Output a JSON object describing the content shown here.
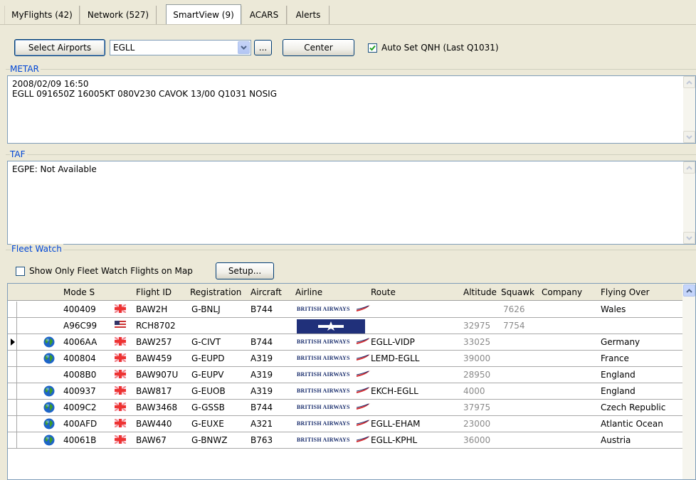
{
  "tabs": [
    {
      "label": "MyFlights (42)"
    },
    {
      "label": "Network (527)"
    },
    {
      "label": "SmartView (9)"
    },
    {
      "label": "ACARS"
    },
    {
      "label": "Alerts"
    }
  ],
  "toolbar": {
    "select_airports_label": "Select Airports",
    "airport_value": "EGLL",
    "ellipsis_label": "...",
    "center_label": "Center",
    "auto_qnh_label": "Auto Set QNH (Last Q1031)",
    "auto_qnh_checked": true
  },
  "metar": {
    "title": "METAR",
    "text": "2008/02/09 16:50\nEGLL 091650Z 16005KT 080V230 CAVOK 13/00 Q1031 NOSIG"
  },
  "taf": {
    "title": "TAF",
    "text": "EGPE: Not Available"
  },
  "fleet_watch": {
    "title": "Fleet Watch",
    "show_only_label": "Show Only Fleet Watch Flights on Map",
    "show_only_checked": false,
    "setup_label": "Setup..."
  },
  "grid": {
    "columns": [
      "Mode S",
      "Flight ID",
      "Registration",
      "Aircraft",
      "Airline",
      "Route",
      "Altitude",
      "Squawk",
      "Company",
      "Flying Over"
    ],
    "airline_logo_text": "BRITISH AIRWAYS",
    "rows": [
      {
        "mode_s": "400409",
        "flag": "uk",
        "globe": false,
        "flight_id": "BAW2H",
        "registration": "G-BNLJ",
        "aircraft": "B744",
        "airline": "ba",
        "route": "",
        "altitude": "",
        "squawk": "7626",
        "company": "",
        "flying_over": "Wales",
        "selected": false
      },
      {
        "mode_s": "A96C99",
        "flag": "us",
        "globe": false,
        "flight_id": "RCH8702",
        "registration": "",
        "aircraft": "",
        "airline": "usaf",
        "route": "",
        "altitude": "32975",
        "squawk": "7754",
        "company": "",
        "flying_over": "",
        "selected": false
      },
      {
        "mode_s": "4006AA",
        "flag": "uk",
        "globe": true,
        "flight_id": "BAW257",
        "registration": "G-CIVT",
        "aircraft": "B744",
        "airline": "ba",
        "route": "EGLL-VIDP",
        "altitude": "33025",
        "squawk": "",
        "company": "",
        "flying_over": "Germany",
        "selected": true
      },
      {
        "mode_s": "400804",
        "flag": "uk",
        "globe": true,
        "flight_id": "BAW459",
        "registration": "G-EUPD",
        "aircraft": "A319",
        "airline": "ba",
        "route": "LEMD-EGLL",
        "altitude": "39000",
        "squawk": "",
        "company": "",
        "flying_over": "France",
        "selected": false
      },
      {
        "mode_s": "4008B0",
        "flag": "uk",
        "globe": false,
        "flight_id": "BAW907U",
        "registration": "G-EUPV",
        "aircraft": "A319",
        "airline": "ba",
        "route": "",
        "altitude": "28950",
        "squawk": "",
        "company": "",
        "flying_over": "England",
        "selected": false
      },
      {
        "mode_s": "400937",
        "flag": "uk",
        "globe": true,
        "flight_id": "BAW817",
        "registration": "G-EUOB",
        "aircraft": "A319",
        "airline": "ba",
        "route": "EKCH-EGLL",
        "altitude": "4000",
        "squawk": "",
        "company": "",
        "flying_over": "England",
        "selected": false
      },
      {
        "mode_s": "4009C2",
        "flag": "uk",
        "globe": true,
        "flight_id": "BAW3468",
        "registration": "G-GSSB",
        "aircraft": "B744",
        "airline": "ba",
        "route": "",
        "altitude": "37975",
        "squawk": "",
        "company": "",
        "flying_over": "Czech Republic",
        "selected": false
      },
      {
        "mode_s": "400AFD",
        "flag": "uk",
        "globe": true,
        "flight_id": "BAW440",
        "registration": "G-EUXE",
        "aircraft": "A321",
        "airline": "ba",
        "route": "EGLL-EHAM",
        "altitude": "23000",
        "squawk": "",
        "company": "",
        "flying_over": "Atlantic Ocean",
        "selected": false
      },
      {
        "mode_s": "40061B",
        "flag": "uk",
        "globe": true,
        "flight_id": "BAW67",
        "registration": "G-BNWZ",
        "aircraft": "B763",
        "airline": "ba",
        "route": "EGLL-KPHL",
        "altitude": "36000",
        "squawk": "",
        "company": "",
        "flying_over": "Austria",
        "selected": false
      }
    ]
  },
  "colors": {
    "window_bg": "#ece9d8",
    "group_title": "#0046d5",
    "ba_blue": "#1b2f6e",
    "ba_red": "#d4262a"
  }
}
